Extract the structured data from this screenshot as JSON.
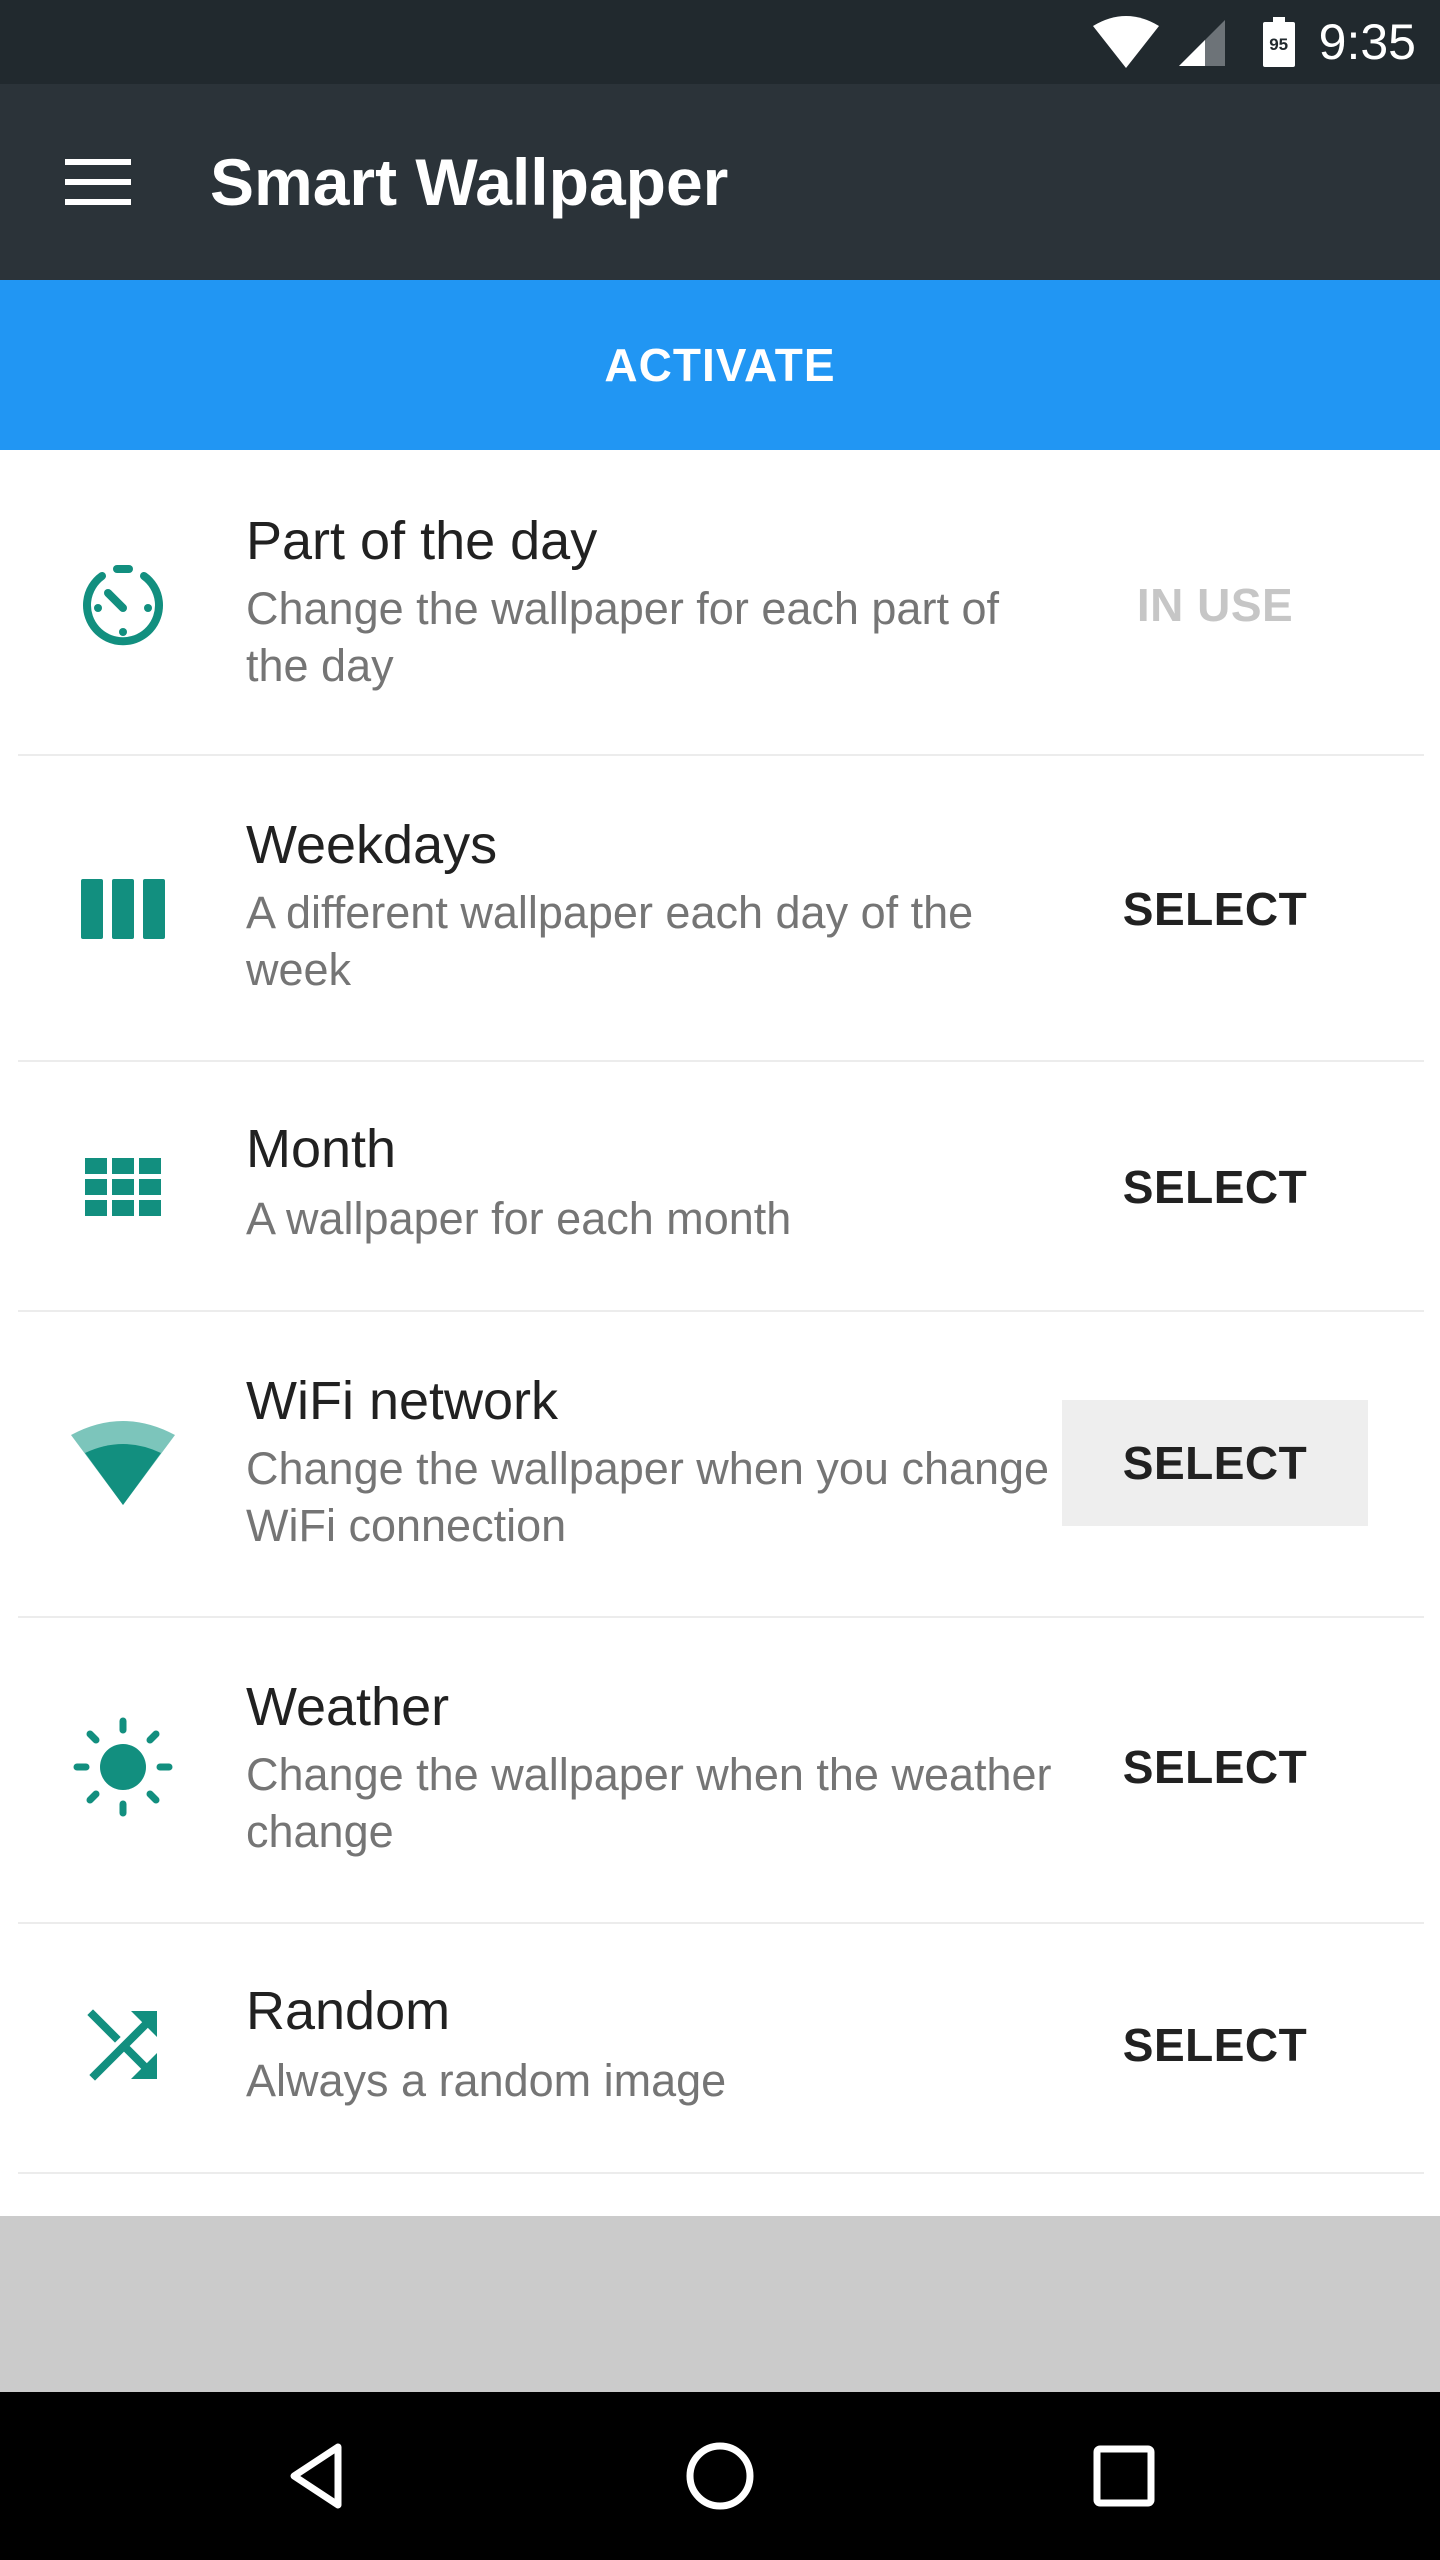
{
  "status_bar": {
    "time": "9:35",
    "battery_level": "95",
    "icons": [
      "wifi-icon",
      "cell-signal-icon",
      "battery-icon"
    ]
  },
  "app_bar": {
    "title": "Smart Wallpaper",
    "menu_icon": "hamburger-menu-icon"
  },
  "activate": {
    "label": "ACTIVATE"
  },
  "colors": {
    "accent": "#2196f3",
    "teal": "#128f7f",
    "app_bar": "#2b3339",
    "status_bar": "#21292e"
  },
  "modes": [
    {
      "icon": "part-of-day-icon",
      "title": "Part of the day",
      "subtitle": "Change the wallpaper for each part of the day",
      "action": "IN USE",
      "state": "in-use"
    },
    {
      "icon": "weekdays-icon",
      "title": "Weekdays",
      "subtitle": "A different wallpaper each day of the week",
      "action": "SELECT",
      "state": "available"
    },
    {
      "icon": "month-grid-icon",
      "title": "Month",
      "subtitle": "A wallpaper for each month",
      "action": "SELECT",
      "state": "available"
    },
    {
      "icon": "wifi-network-icon",
      "title": "WiFi network",
      "subtitle": "Change the wallpaper when you change WiFi connection",
      "action": "SELECT",
      "state": "pressed"
    },
    {
      "icon": "weather-sun-icon",
      "title": "Weather",
      "subtitle": "Change the wallpaper when the weather change",
      "action": "SELECT",
      "state": "available"
    },
    {
      "icon": "shuffle-icon",
      "title": "Random",
      "subtitle": "Always a random image",
      "action": "SELECT",
      "state": "available"
    }
  ],
  "nav_bar": {
    "icons": [
      "back-icon",
      "home-icon",
      "recents-icon"
    ]
  }
}
